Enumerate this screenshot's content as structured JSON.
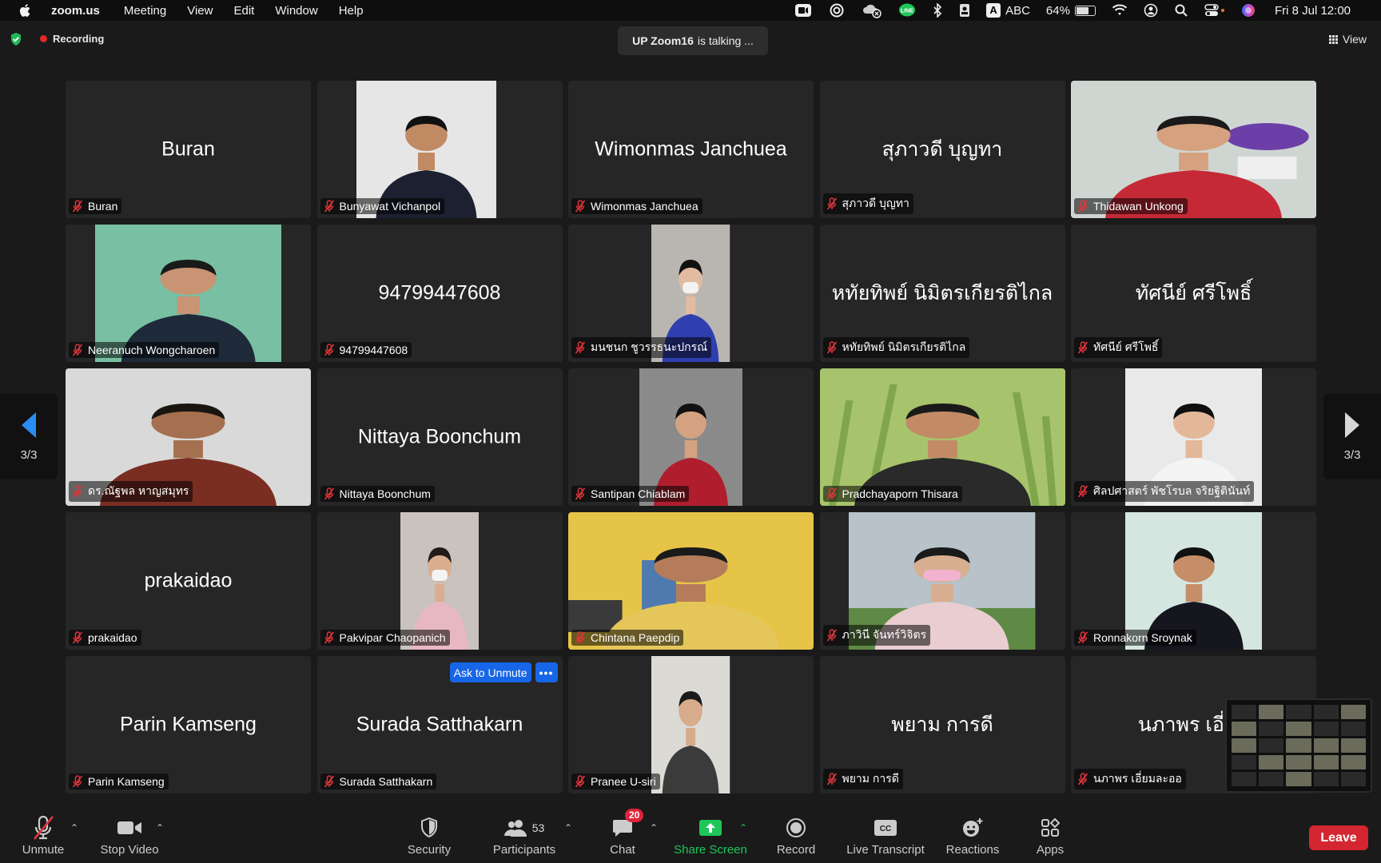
{
  "menubar": {
    "app": "zoom.us",
    "menus": [
      "Meeting",
      "View",
      "Edit",
      "Window",
      "Help"
    ],
    "input_source": "ABC",
    "battery_percent": "64%",
    "battery_level": 0.64,
    "clock": "Fri 8 Jul  12:00"
  },
  "meeting": {
    "recording_label": "Recording",
    "talking_name": "UP Zoom16",
    "talking_suffix": "is talking ...",
    "view_label": "View",
    "page_indicator": "3/3"
  },
  "tiles": [
    {
      "name": "Buran",
      "big_name": "Buran",
      "video": false
    },
    {
      "name": "Bunyawat Vichanpol",
      "video": true,
      "icon": "portrait-suit"
    },
    {
      "name": "Wimonmas Janchuea",
      "big_name": "Wimonmas Janchuea",
      "video": false
    },
    {
      "name": "สุภาวดี บุญทา",
      "big_name": "สุภาวดี บุญทา",
      "video": false
    },
    {
      "name": "Thidawan Unkong",
      "video": true,
      "icon": "portrait-logo"
    },
    {
      "name": "Neeranuch Wongcharoen",
      "video": true,
      "icon": "portrait-green-board"
    },
    {
      "name": "94799447608",
      "big_name": "94799447608",
      "video": false
    },
    {
      "name": "มนชนก ชูวรรธนะปกรณ์",
      "video": true,
      "icon": "portrait-mask"
    },
    {
      "name": "หทัยทิพย์ นิมิตรเกียรติไกล",
      "big_name": "หทัยทิพย์ นิมิตรเกียรติไกล",
      "video": false
    },
    {
      "name": "ทัศนีย์ ศรีโพธิ์",
      "big_name": "ทัศนีย์ ศรีโพธิ์",
      "video": false
    },
    {
      "name": "ดร.ณัฐพล หาญสมุทร",
      "video": true,
      "icon": "portrait-curtain"
    },
    {
      "name": "Nittaya Boonchum",
      "big_name": "Nittaya Boonchum",
      "video": false
    },
    {
      "name": "Santipan Chiablam",
      "video": true,
      "icon": "portrait-red-shirt"
    },
    {
      "name": "Pradchayaporn Thisara",
      "video": true,
      "icon": "portrait-grass"
    },
    {
      "name": "ศิลปศาสตร์ พัชโรบล จริยฐิตินันท์",
      "video": true,
      "icon": "portrait-smile"
    },
    {
      "name": "prakaidao",
      "big_name": "prakaidao",
      "video": false
    },
    {
      "name": "Pakvipar Chaopanich",
      "video": true,
      "icon": "portrait-mask-pink"
    },
    {
      "name": "Chintana Paepdip",
      "video": true,
      "icon": "portrait-yellow-wall"
    },
    {
      "name": "ภาวินี จันทร์วิจิตร",
      "video": true,
      "icon": "portrait-outdoor"
    },
    {
      "name": "Ronnakorn Sroynak",
      "video": true,
      "icon": "portrait-seated"
    },
    {
      "name": "Parin Kamseng",
      "big_name": "Parin Kamseng",
      "video": false
    },
    {
      "name": "Surada Satthakarn",
      "big_name": "Surada Satthakarn",
      "video": false,
      "ask_unmute": "Ask to Unmute"
    },
    {
      "name": "Pranee U-siri",
      "video": true,
      "icon": "portrait-plain"
    },
    {
      "name": "พยาม  การดี",
      "big_name": "พยาม  การดี",
      "video": false
    },
    {
      "name": "นภาพร เอี่ยมละออ",
      "big_name": "นภาพร เอี่ยม",
      "video": false
    }
  ],
  "toolbar": {
    "unmute": "Unmute",
    "stop_video": "Stop Video",
    "security": "Security",
    "participants": "Participants",
    "participants_count": "53",
    "chat": "Chat",
    "chat_badge": "20",
    "share_screen": "Share Screen",
    "record": "Record",
    "live_transcript": "Live Transcript",
    "reactions": "Reactions",
    "apps": "Apps",
    "leave": "Leave"
  },
  "colors": {
    "background": "#1a1a1a",
    "tile": "#262626",
    "muted_red": "#e0353b",
    "share_green": "#1ec65a",
    "leave_red": "#d42630",
    "accent_blue": "#1766e8",
    "pager_blue": "#2a8cf0"
  }
}
